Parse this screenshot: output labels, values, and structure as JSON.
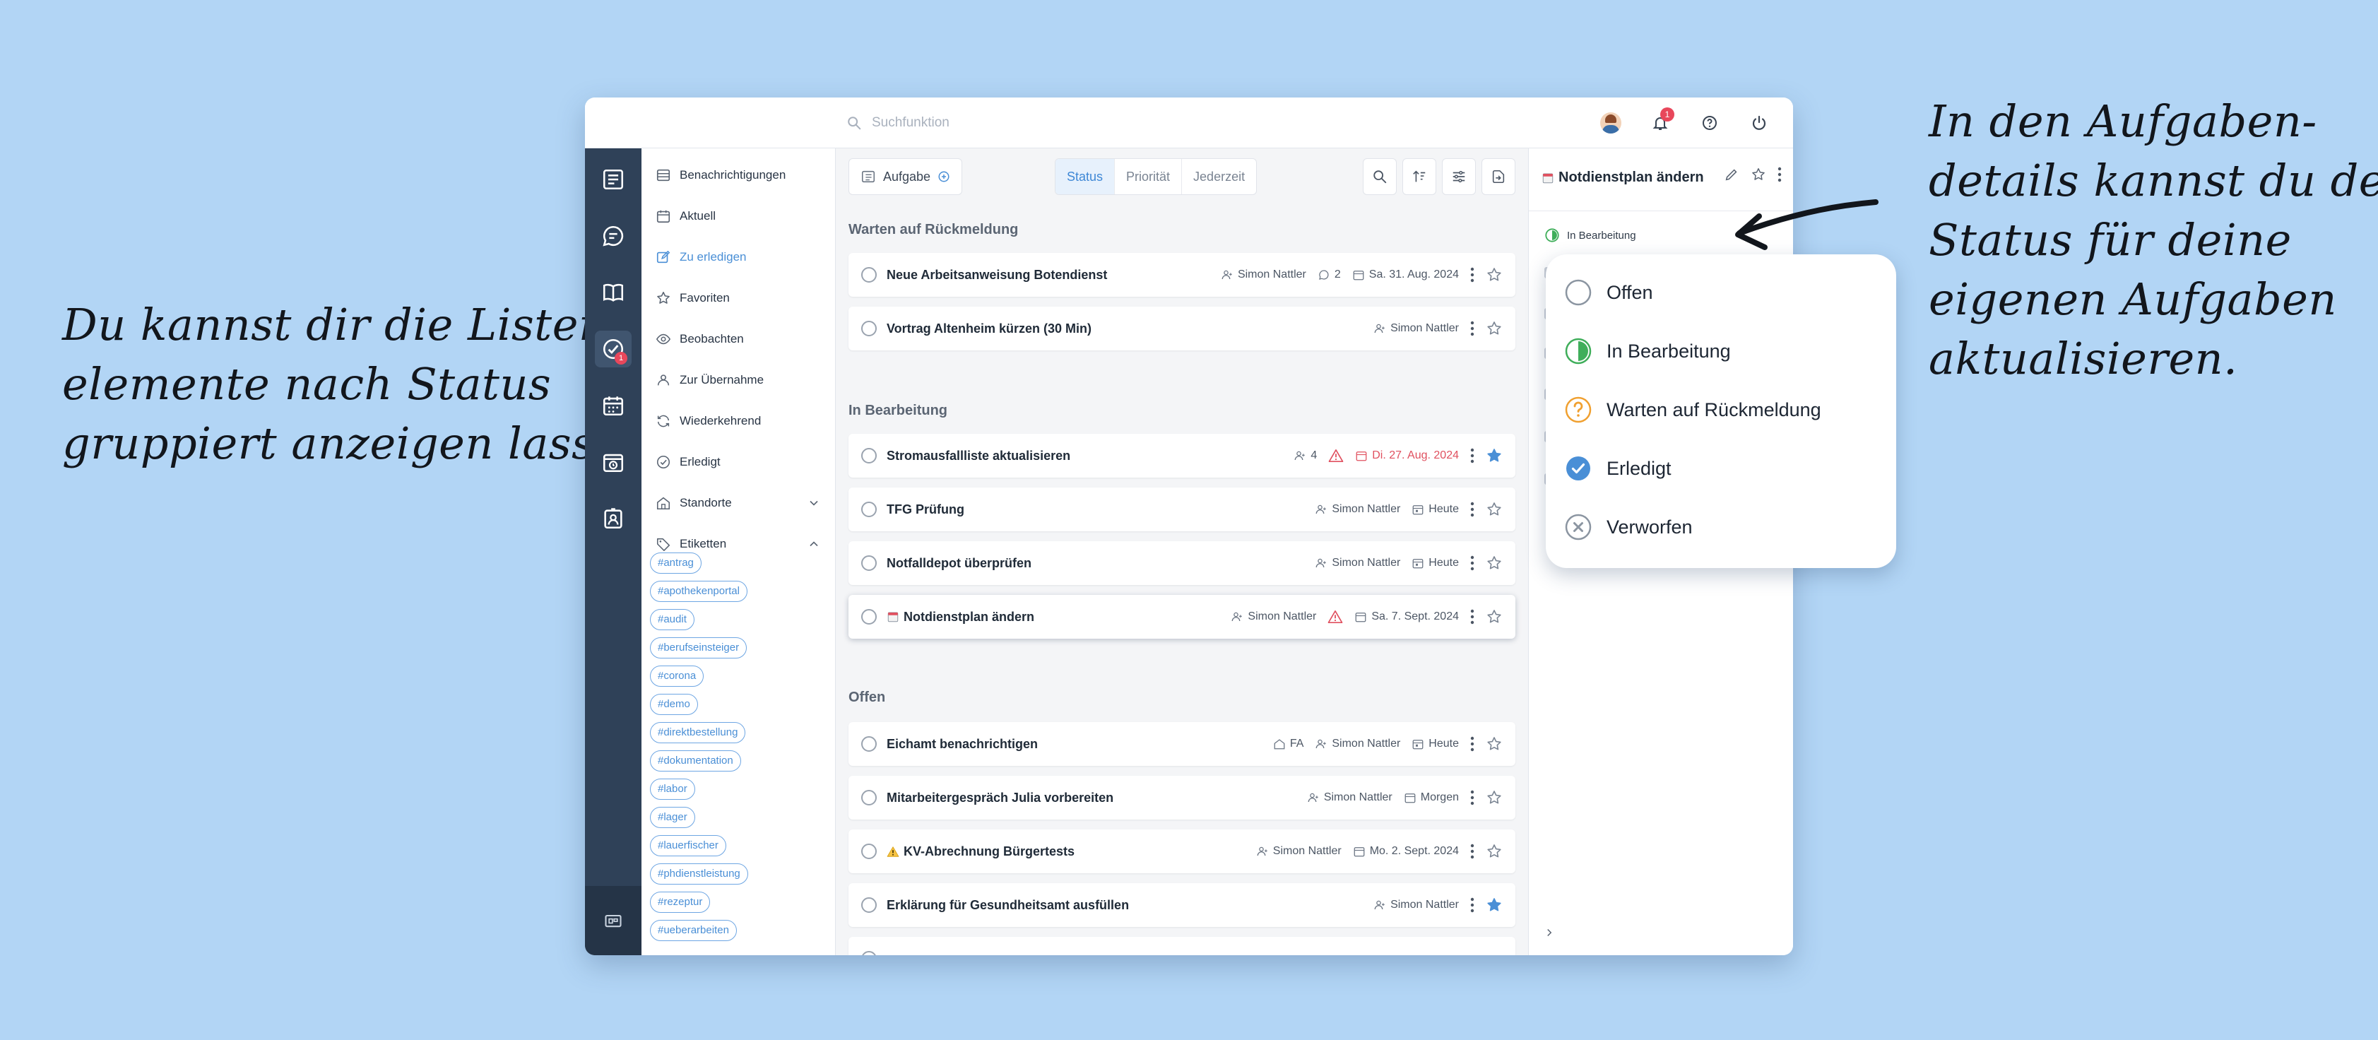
{
  "captions": {
    "left": [
      "Du kannst dir die Listen-",
      "elemente nach Status",
      "gruppiert anzeigen lassen."
    ],
    "right": [
      "In den Aufgaben-",
      "details kannst du den",
      "Status für deine",
      "eigenen Aufgaben",
      "aktualisieren."
    ]
  },
  "topbar": {
    "search_placeholder": "Suchfunktion",
    "notification_count": "1"
  },
  "rail": {
    "tasks_badge": "1"
  },
  "sidebar": {
    "items": [
      {
        "label": "Benachrichtigungen",
        "icon": "list-icon"
      },
      {
        "label": "Aktuell",
        "icon": "calendar-icon"
      },
      {
        "label": "Zu erledigen",
        "icon": "edit-icon"
      },
      {
        "label": "Favoriten",
        "icon": "star-icon"
      },
      {
        "label": "Beobachten",
        "icon": "eye-icon"
      },
      {
        "label": "Zur Übernahme",
        "icon": "take-over-icon"
      },
      {
        "label": "Wiederkehrend",
        "icon": "recurring-icon"
      },
      {
        "label": "Erledigt",
        "icon": "check-circle-icon"
      },
      {
        "label": "Standorte",
        "icon": "location-icon"
      },
      {
        "label": "Etiketten",
        "icon": "tag-icon"
      }
    ],
    "tags": [
      "#antrag",
      "#apothekenportal",
      "#audit",
      "#berufseinsteiger",
      "#corona",
      "#demo",
      "#direktbestellung",
      "#dokumentation",
      "#labor",
      "#lager",
      "#lauerfischer",
      "#phdienstleistung",
      "#rezeptur",
      "#ueberarbeiten"
    ]
  },
  "toolbar": {
    "new_task": "Aufgabe",
    "segments": [
      "Status",
      "Priorität",
      "Jederzeit"
    ]
  },
  "groups": [
    {
      "title": "Warten auf Rückmeldung"
    },
    {
      "title": "In Bearbeitung"
    },
    {
      "title": "Offen"
    }
  ],
  "tasks": [
    {
      "title": "Neue Arbeitsanweisung Botendienst",
      "user": "Simon Nattler",
      "comments": "2",
      "date": "Sa. 31. Aug. 2024"
    },
    {
      "title": "Vortrag Altenheim kürzen (30 Min)",
      "user": "Simon Nattler"
    },
    {
      "title": "Stromausfallliste aktualisieren",
      "users_count": "4",
      "date": "Di. 27. Aug. 2024"
    },
    {
      "title": "TFG Prüfung",
      "user": "Simon Nattler",
      "date": "Heute"
    },
    {
      "title": "Notfalldepot überprüfen",
      "user": "Simon Nattler",
      "date": "Heute"
    },
    {
      "title": "Notdienstplan ändern",
      "user": "Simon Nattler",
      "date": "Sa. 7. Sept. 2024"
    },
    {
      "title": "Eichamt benachrichtigen",
      "location": "FA",
      "user": "Simon Nattler",
      "date": "Heute"
    },
    {
      "title": "Mitarbeitergespräch Julia vorbereiten",
      "user": "Simon Nattler",
      "date": "Morgen"
    },
    {
      "title": "KV-Abrechnung Bürgertests",
      "user": "Simon Nattler",
      "date": "Mo. 2. Sept. 2024"
    },
    {
      "title": "Erklärung für Gesundheitsamt ausfüllen",
      "user": "Simon Nattler"
    }
  ],
  "detail": {
    "title": "Notdienstplan ändern",
    "status": "In Bearbeitung"
  },
  "status_menu": [
    "Offen",
    "In Bearbeitung",
    "Warten auf Rückmeldung",
    "Erledigt",
    "Verworfen"
  ],
  "colors": {
    "background": "#b2d5f5",
    "rail": "#2f4158",
    "accent": "#4a8fd6",
    "danger": "#e0505f",
    "progress": "#3fae5a",
    "waiting": "#f0a030"
  }
}
